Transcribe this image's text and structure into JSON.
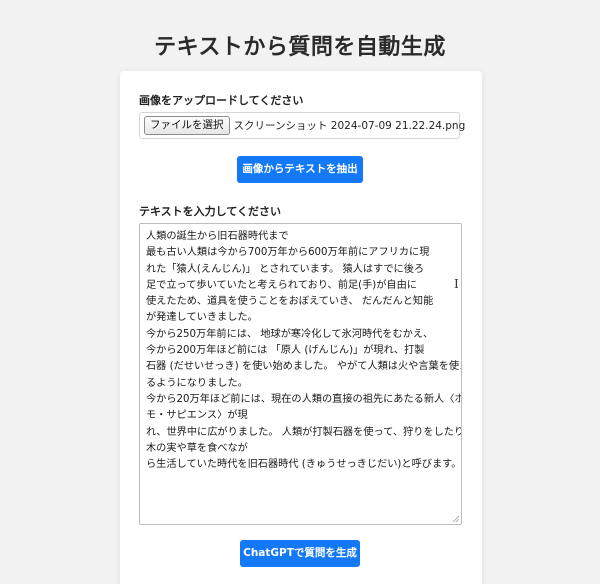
{
  "page": {
    "title": "テキストから質問を自動生成"
  },
  "upload": {
    "label": "画像をアップロードしてください",
    "file_button_label": "ファイルを選択",
    "file_name": "スクリーンショット 2024-07-09 21.22.24.png",
    "extract_button_label": "画像からテキストを抽出"
  },
  "text_input": {
    "label": "テキストを入力してください",
    "lines": [
      "人類の誕生から旧石器時代まで",
      "最も古い人類は今から700万年から600万年前にアフリカに現",
      "れた「猿人(えんじん)」 とされています。 猿人はすでに後ろ",
      "足で立って歩いていたと考えられており、前足(手)が自由に",
      "使えたため、道具を使うことをおぼえていき、 だんだんと知能",
      "が発達していきました。",
      "今から250万年前には、 地球が寒冷化して氷河時代をむかえ、",
      "今から200万年ほど前には 「原人 (げんじん)」が現れ、打製",
      "石器 (だせいせっき) を使い始めました。 やがて人類は火や言葉を使え",
      "るようになりました。",
      "今から20万年ほど前には、現在の人類の直接の祖先にあたる新人〈ホ",
      "モ・サピエンス〉が現",
      "れ、世界中に広がりました。 人類が打製石器を使って、狩りをしたり、",
      "木の実や草を食べなが",
      "ら生活していた時代を旧石器時代 (きゅうせっきじだい)と呼びます。"
    ]
  },
  "generate": {
    "button_label": "ChatGPTで質問を生成"
  },
  "colors": {
    "primary_button": "#1479f6",
    "background": "#f2f2f2",
    "card": "#ffffff"
  },
  "icons": {
    "cursor": "i-beam-cursor-icon",
    "resize": "resize-grip-icon"
  }
}
